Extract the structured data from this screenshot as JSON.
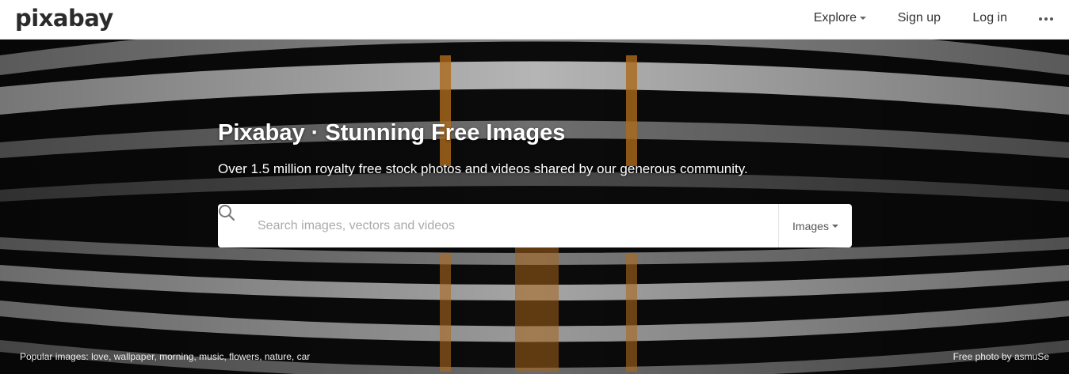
{
  "header": {
    "logo": "pixabay",
    "nav": {
      "explore": "Explore",
      "signup": "Sign up",
      "login": "Log in"
    },
    "more_icon": "more-dots-icon"
  },
  "hero": {
    "title": "Pixabay · Stunning Free Images",
    "subtitle": "Over 1.5 million royalty free stock photos and videos shared by our generous community.",
    "search": {
      "placeholder": "Search images, vectors and videos",
      "value": "",
      "icon": "search-icon",
      "type": "Images"
    },
    "popular_label": "Popular images:",
    "popular_tags": [
      "love",
      "wallpaper",
      "morning",
      "music",
      "flowers",
      "nature",
      "car"
    ],
    "credit_text": "Free photo by",
    "credit_author": "asmuSe"
  },
  "colors": {
    "header_bg": "#ffffff",
    "hero_accent": "#c97a1e",
    "text_dark": "#333333"
  }
}
